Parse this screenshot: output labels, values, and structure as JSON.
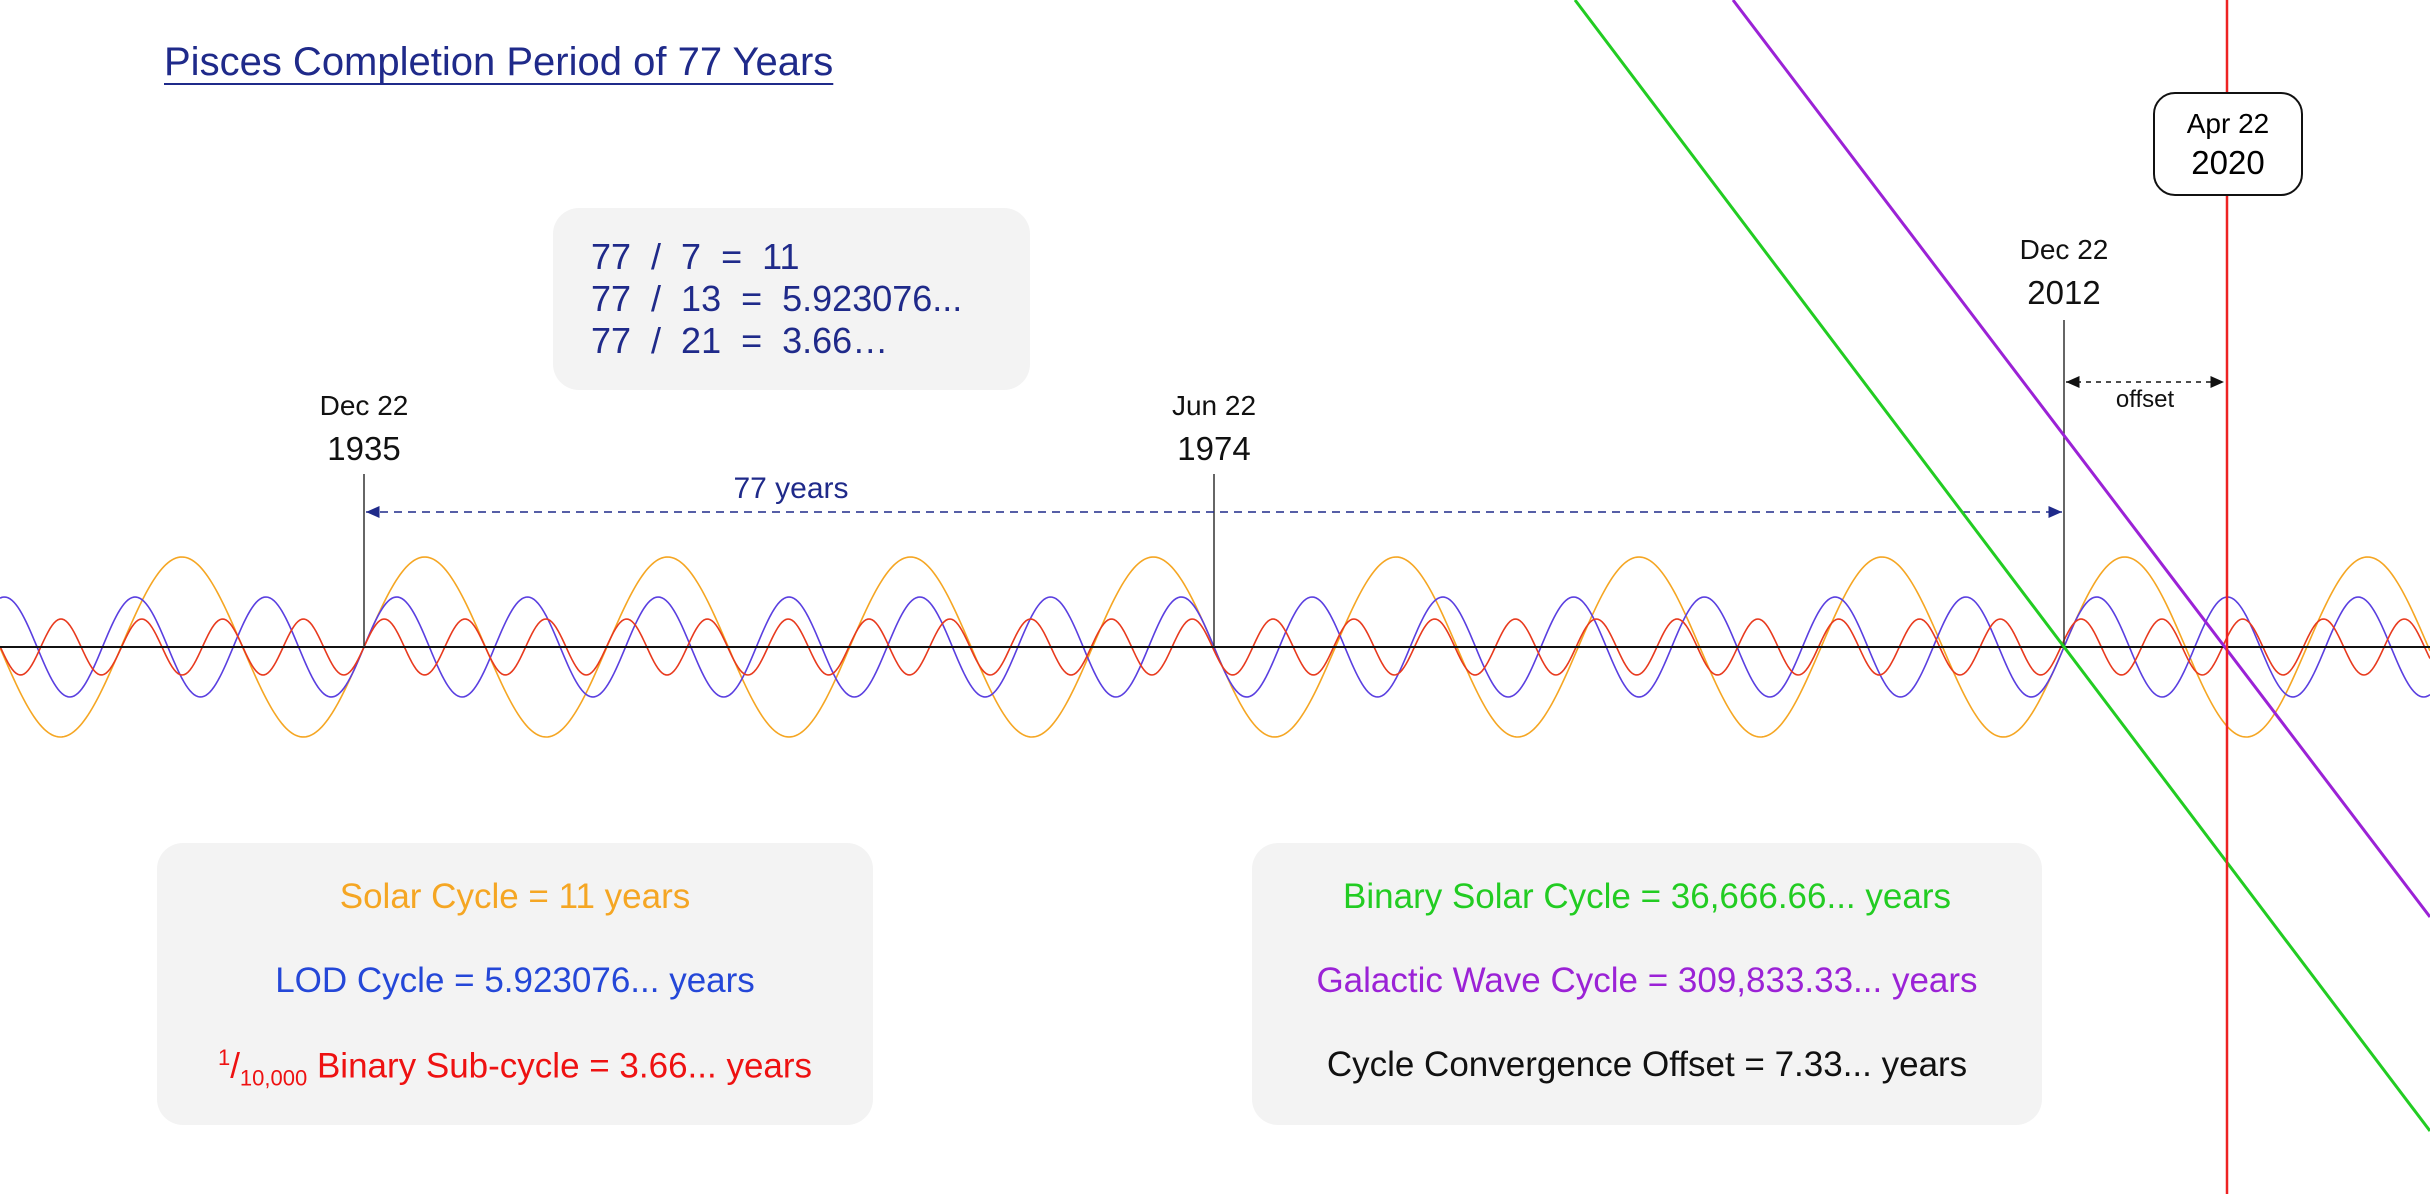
{
  "title": "Pisces Completion Period of 77 Years",
  "divisions": [
    "77  /  7  =  11",
    "77  /  13  =  5.923076...",
    "77  /  21  =  3.66…"
  ],
  "markers": [
    {
      "month_day": "Dec 22",
      "year": "1935"
    },
    {
      "month_day": "Jun 22",
      "year": "1974"
    },
    {
      "month_day": "Dec 22",
      "year": "2012"
    }
  ],
  "current_marker": {
    "month_day": "Apr 22",
    "year": "2020"
  },
  "span_label": "77 years",
  "offset_label": "offset",
  "legend_left": {
    "solar": "Solar Cycle  =  11 years",
    "lod": "LOD Cycle  =  5.923076... years",
    "binary_sup": "1",
    "binary_sub": "10,000",
    "binary_text": " Binary Sub-cycle  =  3.66... years"
  },
  "legend_right": {
    "binary_solar": "Binary Solar Cycle  =  36,666.66... years",
    "galactic": "Galactic Wave Cycle  =  309,833.33... years",
    "convergence": "Cycle Convergence Offset  =  7.33... years"
  },
  "waves": [
    {
      "period_years": 11,
      "color": "#f5a623"
    },
    {
      "period_years": 5.923076,
      "color": "#5a3fe0"
    },
    {
      "period_years": 3.66,
      "color": "#e83a1e"
    }
  ],
  "colors": {
    "title": "#1f2a8a",
    "solar": "#f5a623",
    "lod": "#2447d8",
    "binary": "#ee1111",
    "binary_solar_line": "#22cc22",
    "galactic_line": "#9b22d6",
    "now_line": "#ee2222",
    "axis": "#111111"
  }
}
